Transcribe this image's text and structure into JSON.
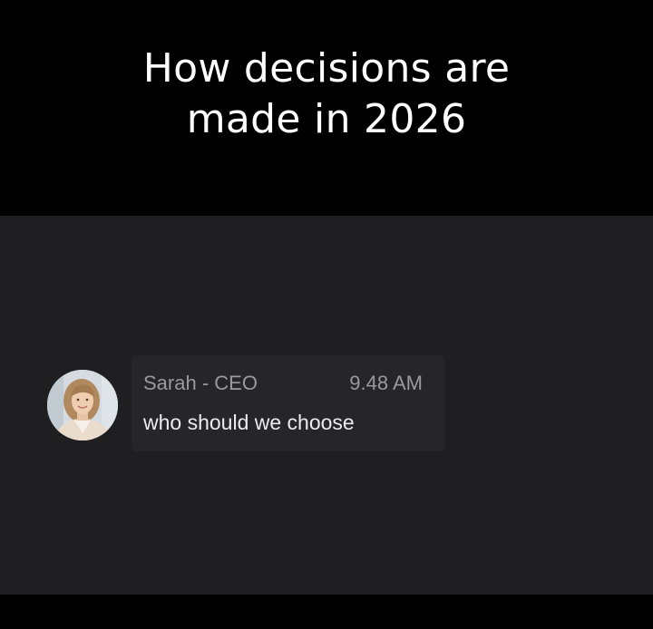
{
  "header": {
    "title_line1": "How decisions are",
    "title_line2": "made in 2026"
  },
  "message": {
    "sender": "Sarah - CEO",
    "time": "9.48 AM",
    "text": "who should we choose",
    "avatar_icon": "user-avatar-photo"
  },
  "colors": {
    "background_top": "#000000",
    "chat_background": "#1f1f21",
    "bubble_background": "#262628",
    "title_text": "#ffffff",
    "meta_text": "#9a9a9c",
    "message_text": "#ececec"
  }
}
